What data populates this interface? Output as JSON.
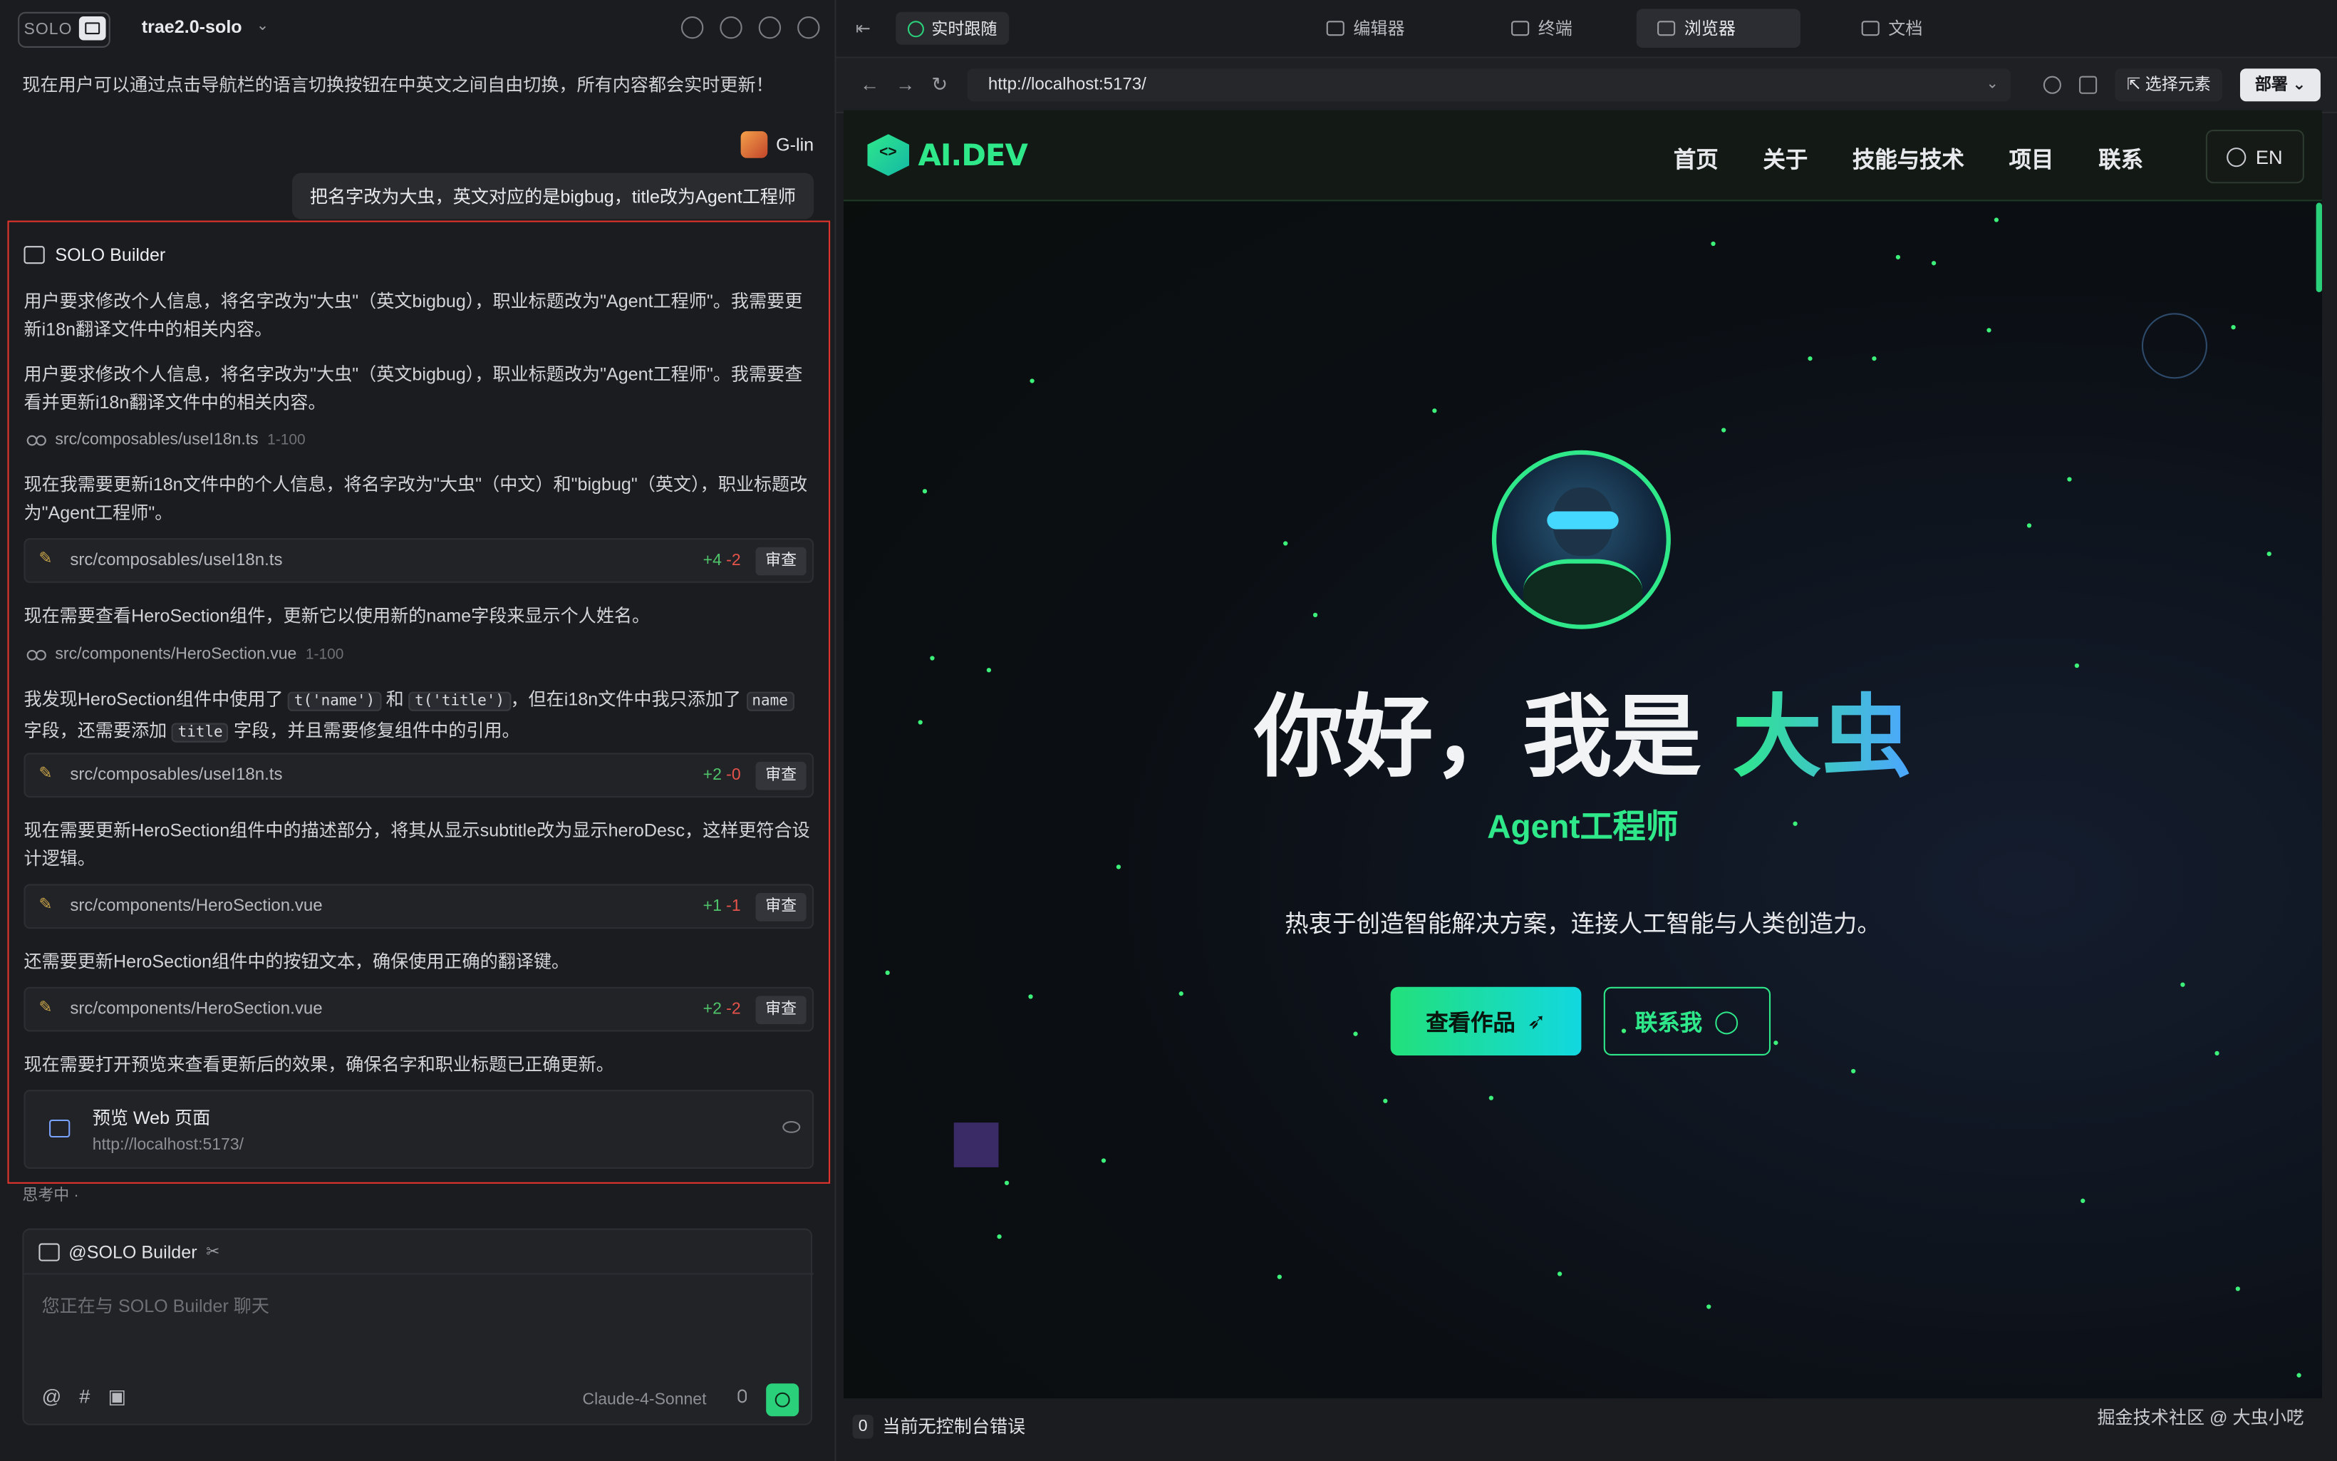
{
  "left": {
    "badge": "SOLO",
    "project": "trae2.0-solo",
    "intro_message": "现在用户可以通过点击导航栏的语言切换按钮在中英文之间自由切换，所有内容都会实时更新！",
    "user_name": "G-lin",
    "user_message": "把名字改为大虫，英文对应的是bigbug，title改为Agent工程师",
    "builder_title": "SOLO Builder",
    "p1": "用户要求修改个人信息，将名字改为\"大虫\"（英文bigbug），职业标题改为\"Agent工程师\"。我需要更新i18n翻译文件中的相关内容。",
    "p2": "用户要求修改个人信息，将名字改为\"大虫\"（英文bigbug），职业标题改为\"Agent工程师\"。我需要查看并更新i18n翻译文件中的相关内容。",
    "read1_file": "src/composables/useI18n.ts",
    "read1_range": "1-100",
    "p3": "现在我需要更新i18n文件中的个人信息，将名字改为\"大虫\"（中文）和\"bigbug\"（英文），职业标题改为\"Agent工程师\"。",
    "edit1": {
      "file": "src/composables/useI18n.ts",
      "plus": "+4",
      "minus": "-2",
      "review": "审查"
    },
    "p4": "现在需要查看HeroSection组件，更新它以使用新的name字段来显示个人姓名。",
    "read2_file": "src/components/HeroSection.vue",
    "read2_range": "1-100",
    "p5_a": "我发现HeroSection组件中使用了",
    "p5_code1": "t('name')",
    "p5_b": "和",
    "p5_code2": "t('title')",
    "p5_c": "，但在i18n文件中我只添加了",
    "p5_code3": "name",
    "p5_d": "字段，还需要添加",
    "p5_code4": "title",
    "p5_e": "字段，并且需要修复组件中的引用。",
    "edit2": {
      "file": "src/composables/useI18n.ts",
      "plus": "+2",
      "minus": "-0",
      "review": "审查"
    },
    "p6": "现在需要更新HeroSection组件中的描述部分，将其从显示subtitle改为显示heroDesc，这样更符合设计逻辑。",
    "edit3": {
      "file": "src/components/HeroSection.vue",
      "plus": "+1",
      "minus": "-1",
      "review": "审查"
    },
    "p7": "还需要更新HeroSection组件中的按钮文本，确保使用正确的翻译键。",
    "edit4": {
      "file": "src/components/HeroSection.vue",
      "plus": "+2",
      "minus": "-2",
      "review": "审查"
    },
    "p8": "现在需要打开预览来查看更新后的效果，确保名字和职业标题已正确更新。",
    "preview_title": "预览 Web 页面",
    "preview_url": "http://localhost:5173/",
    "thinking": "思考中 ·",
    "composer_mention": "@SOLO Builder",
    "composer_placeholder": "您正在与 SOLO Builder 聊天",
    "model": "Claude-4-Sonnet"
  },
  "right": {
    "live_tab": "实时跟随",
    "tabs": [
      "编辑器",
      "终端",
      "浏览器",
      "文档"
    ],
    "url": "http://localhost:5173/",
    "pick_element": "选择元素",
    "deploy": "部署",
    "site": {
      "logo": "AI.DEV",
      "nav": [
        "首页",
        "关于",
        "技能与技术",
        "项目",
        "联系"
      ],
      "lang": "EN",
      "hero_prefix": "你好，我是 ",
      "hero_name": "大虫",
      "hero_sub": "Agent工程师",
      "hero_desc": "热衷于创造智能解决方案，连接人工智能与人类创造力。",
      "btn_primary": "查看作品",
      "btn_secondary": "联系我"
    },
    "console_count": "0",
    "console_text": "当前无控制台错误",
    "watermark": "掘金技术社区 @ 大虫小呓"
  },
  "colors": {
    "accent": "#2ee88a",
    "highlight_border": "#e0342d"
  }
}
